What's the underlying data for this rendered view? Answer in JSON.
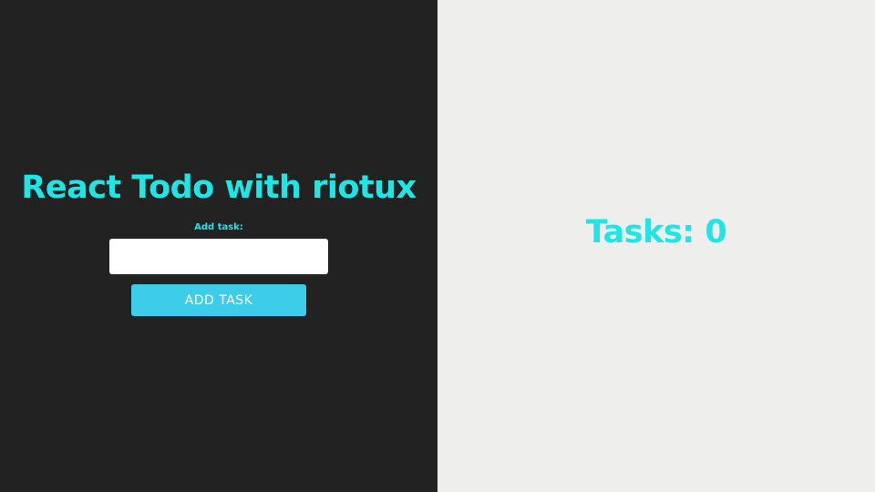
{
  "theme": {
    "accent": "#1ee6e6",
    "button": "#3dcde8",
    "left_bg": "#222222",
    "right_bg": "#eeeeec"
  },
  "form": {
    "title": "React Todo with riotux",
    "label": "Add task:",
    "input_value": "",
    "input_placeholder": "",
    "button_label": "ADD TASK"
  },
  "tasks": {
    "summary": "Tasks: 0"
  }
}
